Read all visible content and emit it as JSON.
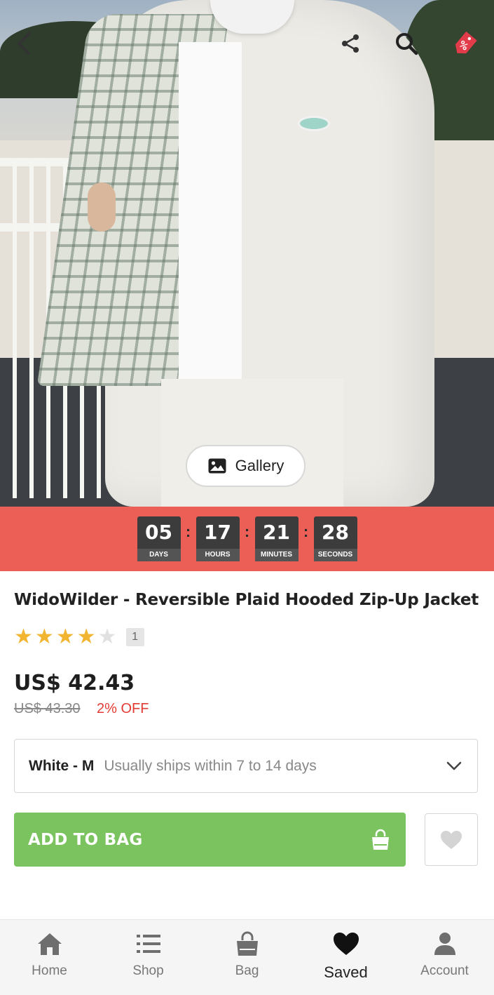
{
  "gallery": {
    "label": "Gallery"
  },
  "countdown": {
    "days": "05",
    "days_label": "DAYS",
    "hours": "17",
    "hours_label": "HOURS",
    "minutes": "21",
    "minutes_label": "MINUTES",
    "seconds": "28",
    "seconds_label": "SECONDS"
  },
  "product": {
    "title": "WidoWilder - Reversible Plaid Hooded Zip-Up Jacket",
    "rating": 4,
    "rating_max": 5,
    "review_count": "1",
    "price": "US$ 42.43",
    "old_price": "US$ 43.30",
    "discount": "2% OFF"
  },
  "variant": {
    "selected": "White - M",
    "shipping": "Usually ships within 7 to 14 days"
  },
  "actions": {
    "add_to_bag": "ADD TO BAG"
  },
  "nav": {
    "items": [
      {
        "label": "Home",
        "icon": "home-icon"
      },
      {
        "label": "Shop",
        "icon": "list-icon"
      },
      {
        "label": "Bag",
        "icon": "bag-icon"
      },
      {
        "label": "Saved",
        "icon": "heart-icon",
        "active": true
      },
      {
        "label": "Account",
        "icon": "user-icon"
      }
    ]
  },
  "colors": {
    "countdown_bg": "#ec5f57",
    "add_to_bag_bg": "#7ac35f",
    "discount": "#e23b34",
    "star": "#f2b531"
  }
}
